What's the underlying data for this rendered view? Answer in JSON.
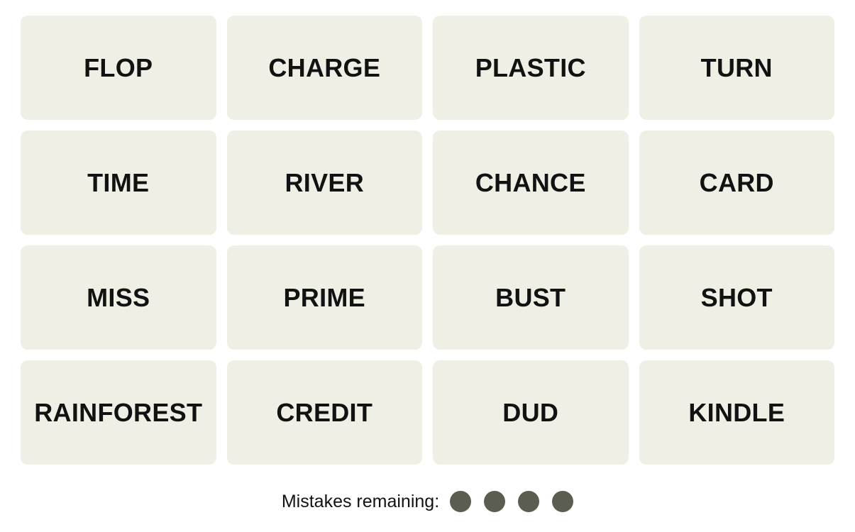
{
  "theme": {
    "page_background": "#FFFFFF",
    "tile_background": "#EFEFE6",
    "tile_text_color": "#121212",
    "mistake_dot_color": "#5A5D50"
  },
  "board": {
    "rows": 4,
    "columns": 4,
    "tiles": [
      {
        "label": "FLOP"
      },
      {
        "label": "CHARGE"
      },
      {
        "label": "PLASTIC"
      },
      {
        "label": "TURN"
      },
      {
        "label": "TIME"
      },
      {
        "label": "RIVER"
      },
      {
        "label": "CHANCE"
      },
      {
        "label": "CARD"
      },
      {
        "label": "MISS"
      },
      {
        "label": "PRIME"
      },
      {
        "label": "BUST"
      },
      {
        "label": "SHOT"
      },
      {
        "label": "RAINFOREST"
      },
      {
        "label": "CREDIT"
      },
      {
        "label": "DUD"
      },
      {
        "label": "KINDLE"
      }
    ]
  },
  "mistakes": {
    "label": "Mistakes remaining:",
    "remaining": 4,
    "dots": [
      {
        "state": "filled"
      },
      {
        "state": "filled"
      },
      {
        "state": "filled"
      },
      {
        "state": "filled"
      }
    ]
  }
}
